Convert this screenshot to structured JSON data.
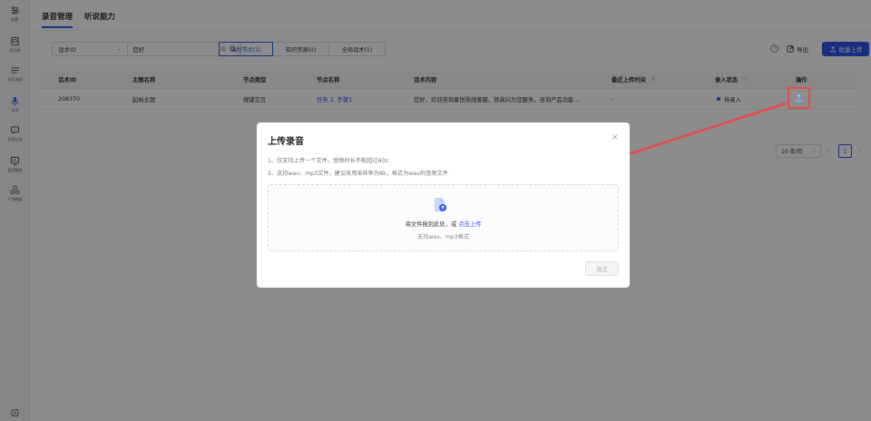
{
  "sidebar": {
    "items": [
      {
        "label": "配置",
        "icon": "sliders-icon"
      },
      {
        "label": "知识库",
        "icon": "book-icon"
      },
      {
        "label": "对话流程",
        "icon": "flow-icon"
      },
      {
        "label": "录音",
        "icon": "mic-icon"
      },
      {
        "label": "对话记录",
        "icon": "chat-icon"
      },
      {
        "label": "监控数据",
        "icon": "monitor-icon"
      },
      {
        "label": "干预数据",
        "icon": "nodes-icon"
      }
    ],
    "active": "录音"
  },
  "header": {
    "tabs": [
      {
        "label": "录音管理",
        "active": true
      },
      {
        "label": "听说能力",
        "active": false
      }
    ]
  },
  "filters": {
    "field_select": "话术ID",
    "search_value": "您好",
    "segments": [
      "流程节点(1)",
      "知识资源(0)",
      "全局话术(1)"
    ],
    "active_segment": "流程节点(1)",
    "help": "?",
    "export_label": "导出",
    "batch_upload_label": "批量上传"
  },
  "table": {
    "columns": [
      "话术ID",
      "主题名称",
      "节点类型",
      "节点名称",
      "话术内容",
      "最近上传时间",
      "录入状态",
      "操作"
    ],
    "rows": [
      {
        "id": "208370",
        "topic": "起始主题",
        "node_type": "搜键交互",
        "node_name": "任务 2, 步骤1",
        "content": "您好，欢迎咨询客悦热线客服，很高兴为您服务，咨询产品功能...",
        "last_upload": "-",
        "status": "待录入"
      }
    ]
  },
  "pagination": {
    "page_size": "10 条/页",
    "current_page": "1"
  },
  "modal": {
    "title": "上传录音",
    "close": "×",
    "notes": [
      "1、仅支持上传一个文件，音频时长不能超过60s",
      "2、支持wav、mp3文件，建议采用采样率为8k，格式为wav的音频文件"
    ],
    "drop_text": "将文件拖到此处，或",
    "drop_link": "点击上传",
    "drop_hint": "支持wav、mp3格式",
    "confirm_label": "确定"
  },
  "colors": {
    "primary": "#2f54eb",
    "annotation": "#e84a4a"
  }
}
